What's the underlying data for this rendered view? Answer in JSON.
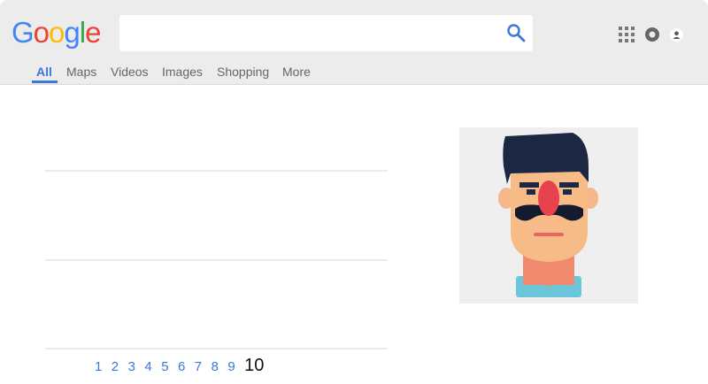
{
  "logo": {
    "letters": [
      {
        "char": "G",
        "color": "#4285f4"
      },
      {
        "char": "o",
        "color": "#ea4335"
      },
      {
        "char": "o",
        "color": "#fbbc05"
      },
      {
        "char": "g",
        "color": "#4285f4"
      },
      {
        "char": "l",
        "color": "#34a853"
      },
      {
        "char": "e",
        "color": "#ea4335"
      }
    ]
  },
  "search": {
    "value": "",
    "placeholder": "",
    "icon": "search-icon"
  },
  "header_icons": [
    "apps-icon",
    "notifications-icon",
    "account-icon"
  ],
  "tabs": [
    {
      "label": "All",
      "active": true
    },
    {
      "label": "Maps",
      "active": false
    },
    {
      "label": "Videos",
      "active": false
    },
    {
      "label": "Images",
      "active": false
    },
    {
      "label": "Shopping",
      "active": false
    },
    {
      "label": "More",
      "active": false
    }
  ],
  "pagination": {
    "pages": [
      "1",
      "2",
      "3",
      "4",
      "5",
      "6",
      "7",
      "8",
      "9",
      "10"
    ],
    "current": "10"
  },
  "colors": {
    "accent": "#3b78d8",
    "header_bg": "#ececec",
    "knowledge_bg": "#efefef"
  }
}
